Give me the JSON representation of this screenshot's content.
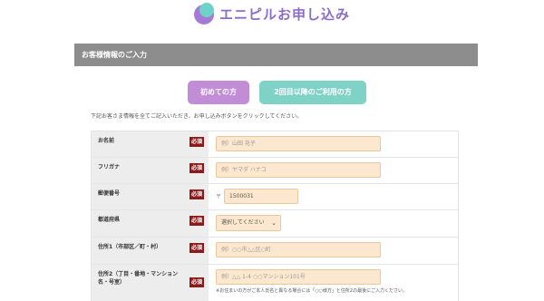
{
  "header": {
    "title": "エニピルお申し込み"
  },
  "section": {
    "title": "お客様情報のご入力"
  },
  "tabs": [
    {
      "label": "初めての方",
      "color": "#c08dd6"
    },
    {
      "label": "2回目以降のご利用の方",
      "color": "#7fd2c6"
    }
  ],
  "instructions": "下記お客さま情報を全てご記入いただき、お申し込みボタンをクリックしてください。",
  "required_label": "必須",
  "fields": {
    "name": {
      "label": "お名前",
      "placeholder": "例）山田 花子"
    },
    "kana": {
      "label": "フリガナ",
      "placeholder": "例）ヤマダ ハナコ"
    },
    "zip": {
      "label": "郵便番号",
      "mark": "〒",
      "value": "1500031"
    },
    "prefecture": {
      "label": "都道府県",
      "selected": "選択してください"
    },
    "address1": {
      "label": "住所1（市部区／町・村）",
      "placeholder": "例）○○市△△区○町"
    },
    "address2": {
      "label": "住所2（丁目・番地・マンション名・号室）",
      "placeholder": "例）△△ 1-4 ○○マンション101号",
      "note": "※お住まいの方がご本人氏名と異なる場合には「○○様方」と住所2の最後にご入力ください。"
    }
  },
  "colors": {
    "brand": "#8e6cc9",
    "header_bar": "#8d8d8d",
    "required_badge": "#8b1a1a",
    "input_bg": "#fde8cf"
  }
}
